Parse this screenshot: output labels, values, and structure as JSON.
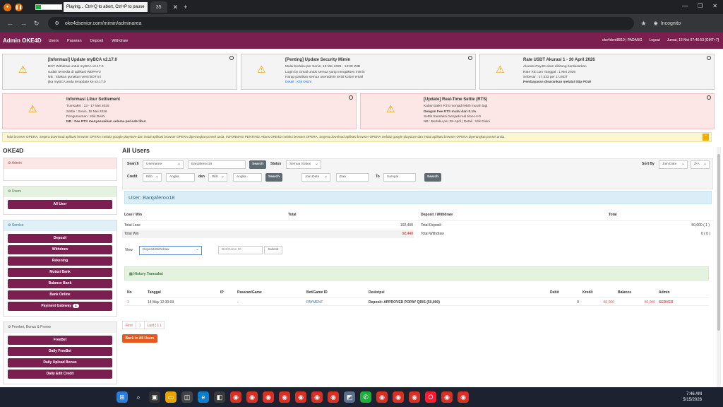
{
  "browser": {
    "playing_text": "Playing... Ctrl+Q to abort, Ctrl+P to pause",
    "progress_fraction": 0.2,
    "tab_label": "35",
    "url": "oke4dsenior.com/mimin/adminarea",
    "incognito": "Incognito"
  },
  "header": {
    "brand": "Admin OKE4D",
    "menu": [
      "Users",
      "Pasaran",
      "Deposit",
      "Withdraw"
    ],
    "user": "oke4dent8810 | PADANG",
    "logout": "Logout",
    "datetime": "Jumat, 15 Mei 07:46:53 [GMT+7]"
  },
  "notices": [
    {
      "title": "[Informasi] Update myBCA v2.17.0",
      "lines": [
        "BOT Withdraw untuk myBCA v2.17.0",
        "sudah tersedia di aplikasi WDPAY2",
        "NB : Silakan gunakan versi BOT ini",
        "jika myBCA anda terupdate ke v2.17.0"
      ]
    },
    {
      "title": "[Penting] Update Security Mimin",
      "lines": [
        "Mulai berlaku per Senin, 18 Mei 2026 - 13:00 WIB",
        "Login by Gmail untuk semua yang mengakses mimin",
        "Harap pastikan semua useradmin terisi kolom email",
        "Detail : Klik Disini"
      ]
    },
    {
      "title": "Rate USDT Akurasi 1 - 30 April 2026",
      "lines": [
        "Akurasi Pay4D akan dihitung berdasarkan",
        "Rate XE.com Tanggal : 1 Mei 2026",
        "Sebesar : 17,333 per 1 USDT",
        "Pembayaran disarankan melalui titip PGW"
      ]
    },
    {
      "title": "Informasi Libur Settlement",
      "lines": [
        "Transaksi : 13 - 17 Mei 2026",
        "Settle : Senin, 18 Mei 2026",
        "Pengumuman : Klik Disini",
        "NB : Fee RTS menyesuaikan selama periode libur"
      ]
    },
    {
      "title": "[Update] Real-Time Settle (RTS)",
      "lines": [
        "Kabar Baik!! RTS menjadi lebih murah lagi",
        "Dengan Fee RTS mulai dari 0.1%",
        "Settle transaksi menjadi real time H+0",
        "NB : Berlaku per 28-April | Detail : Klik Disini"
      ]
    }
  ],
  "ticker": "lalui browser OPERA, Segera download aplikasi browser OPERA melalui google playstore dan instal aplikasi browser OPERA diperangkat ponsel anda.                   INFORMASI PENTING! Akses OKE4D melalui browser OPERA, Segera download aplikasi browser OPERA melalui google playstore dan instal aplikasi browser OPERA diperangkat ponsel anda.",
  "sidebar": {
    "title": "OKE4D",
    "admin": "Admin",
    "users": "Users",
    "users_buttons": [
      "All User"
    ],
    "service": "Service",
    "service_buttons": [
      "Deposit",
      "Withdraw",
      "Rekening",
      "Mutasi Bank",
      "Balance Bank",
      "Bank Online",
      "Payment Gateway"
    ],
    "payment_badge": "4",
    "promo": "Freebet, Bonus & Promo",
    "promo_buttons": [
      "FreeBet",
      "Daily FreeBet",
      "Daily Upload Bonus",
      "Daily Edit Credit"
    ]
  },
  "main": {
    "title": "All Users",
    "filter": {
      "search_label": "Search",
      "search_by": "Username",
      "search_value": "Barqaferoo18",
      "search_btn": "Search",
      "status_label": "Status",
      "status_value": "Semua Status",
      "sort_label": "Sort By",
      "sort_value": "Join Date",
      "sort_dir": "Z-A",
      "credit_label": "Credit",
      "pilih1": "Pilih",
      "angka1": "Angka",
      "dan": "dan",
      "pilih2": "Pilih",
      "angka2": "Angka",
      "join_value": "Join Date",
      "dari": "Dari",
      "to": "To",
      "sampai": "Sampai"
    },
    "user_bar": "User: Barqaferoo18",
    "stats": {
      "winlose_h": "Lose / Win",
      "total_h": "Total",
      "dw_h": "Deposit / Withdraw",
      "total_h2": "Total",
      "total_lose": "Total Lose",
      "total_lose_v": "192,400",
      "total_win": "Total Win",
      "total_win_v": "92,440",
      "total_dep": "Total Deposit",
      "total_dep_v": "50,000 ( 1 )",
      "total_wd": "Total Withdraw",
      "total_wd_v": "0 ( 0 )"
    },
    "view_label": "View",
    "view_value": "Deposit/Withdraw",
    "bet_placeholder": "Bet/Game ID",
    "submit": "Submit",
    "history_title": "History Transaksi",
    "table": {
      "headers": [
        "No",
        "Tanggal",
        "IP",
        "Pasaran/Game",
        "Bet/Game ID",
        "Deskripsi",
        "Debit",
        "Kredit",
        "Balance",
        "Admin"
      ],
      "rows": [
        [
          "1",
          "14 May 12:30:03",
          "",
          "-",
          "PAYMENT",
          "Deposit: APPROVED POPAY QRIS (50,000)",
          "0",
          "50,000",
          "50,000",
          "SERVER"
        ]
      ]
    },
    "pager": [
      "First",
      "1",
      "Last ( 1 )"
    ],
    "back": "Back to All Users"
  },
  "clock": {
    "time": "7:46 AM",
    "date": "5/15/2026"
  }
}
